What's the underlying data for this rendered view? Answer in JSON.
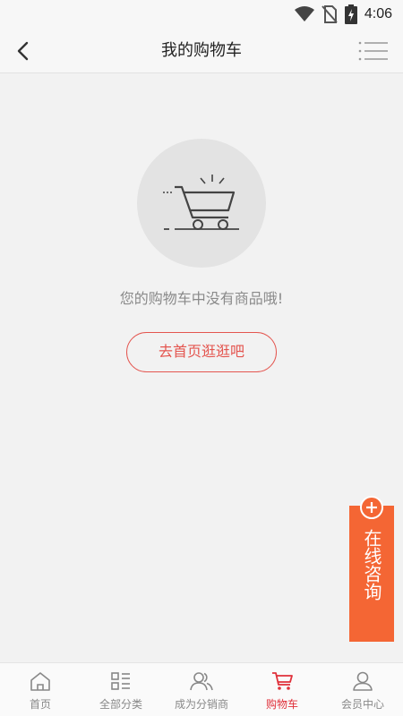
{
  "status_bar": {
    "time": "4:06",
    "icons": [
      "wifi-icon",
      "no-sim-icon",
      "battery-charging-icon"
    ]
  },
  "header": {
    "title": "我的购物车",
    "back_icon": "chevron-left-icon",
    "menu_icon": "list-menu-icon"
  },
  "empty_state": {
    "icon": "empty-cart-icon",
    "message": "您的购物车中没有商品哦!",
    "button_label": "去首页逛逛吧"
  },
  "consult": {
    "icon": "plus-icon",
    "label": "在线咨询"
  },
  "tabbar": {
    "active_color": "#e0303a",
    "inactive_color": "#888888",
    "items": [
      {
        "label": "首页",
        "icon": "home-icon",
        "active": false
      },
      {
        "label": "全部分类",
        "icon": "category-icon",
        "active": false
      },
      {
        "label": "成为分销商",
        "icon": "users-icon",
        "active": false
      },
      {
        "label": "购物车",
        "icon": "cart-icon",
        "active": true
      },
      {
        "label": "会员中心",
        "icon": "user-icon",
        "active": false
      }
    ]
  },
  "colors": {
    "accent_red": "#e4554f",
    "consult_orange": "#f46634",
    "background": "#f2f2f2"
  }
}
